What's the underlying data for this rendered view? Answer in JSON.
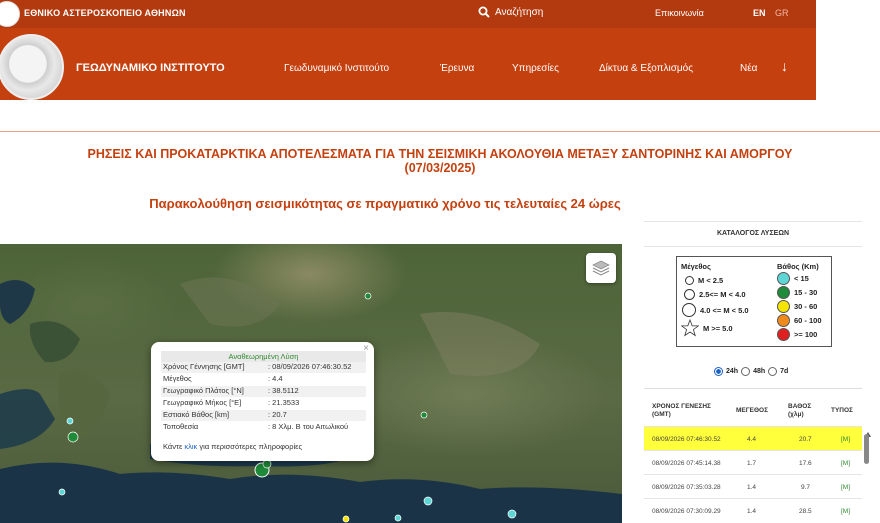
{
  "topbar": {
    "org_name": "ΕΘΝΙΚΟ ΑΣΤΕΡΟΣΚΟΠΕΙΟ ΑΘΗΝΩΝ",
    "search_label": "Αναζήτηση",
    "contact": "Επικοινωνία",
    "lang_en": "EN",
    "lang_gr": "GR"
  },
  "navbar": {
    "institute": "ΓΕΩΔΥΝΑΜΙΚΟ ΙΝΣΤΙΤΟΥΤΟ",
    "items": [
      "Γεωδυναμικό Ινστιτούτο",
      "Έρευνα",
      "Υπηρεσίες",
      "Δίκτυα & Εξοπλισμός",
      "Νέα"
    ],
    "arrow": "↓"
  },
  "headline": {
    "line1": "ΡΗΣΕΙΣ ΚΑΙ ΠΡΟΚΑΤΑΡΚΤΙΚΑ ΑΠΟΤΕΛΕΣΜΑΤΑ ΓΙΑ ΤΗΝ ΣΕΙΣΜΙΚΗ ΑΚΟΛΟΥΘΙΑ ΜΕΤΑΞΥ ΣΑΝΤΟΡΙΝΗΣ ΚΑΙ ΑΜΟΡΓΟΥ",
    "line2": "(07/03/2025)"
  },
  "subheadline": "Παρακολούθηση σεισμικότητας σε πραγματικό χρόνο τις τελευταίες 24 ώρες",
  "popup": {
    "title": "Αναθεωρημένη Λύση",
    "close": "×",
    "rows": [
      {
        "k": "Χρόνος Γέννησης [GMT]",
        "v": ": 08/09/2026 07:46:30.52"
      },
      {
        "k": "Μέγεθος",
        "v": ": 4.4"
      },
      {
        "k": "Γεωγραφικό Πλάτος [°N]",
        "v": ": 38.5112"
      },
      {
        "k": "Γεωγραφικό Μήκος [°E]",
        "v": ": 21.3533"
      },
      {
        "k": "Εστιακό Βάθος [km]",
        "v": ": 20.7"
      },
      {
        "k": "Τοποθεσία",
        "v": ": 8 Χλμ. Β του Αιτωλικού"
      }
    ],
    "more_pre": "Κάντε ",
    "more_link": "κλικ",
    "more_post": " για περισσότερες πληροφορίες"
  },
  "sidebar": {
    "catalog_title": "ΚΑΤΑΛΟΓΟΣ ΛΥΣΕΩΝ",
    "legend": {
      "mag_header": "Μέγεθος",
      "depth_header": "Βάθος (Km)",
      "mag_items": [
        "M < 2.5",
        "2.5<= M < 4.0",
        "4.0 <= M < 5.0",
        "M >= 5.0"
      ],
      "depth_items": [
        {
          "label": "< 15",
          "color": "#5fd6d6"
        },
        {
          "label": "15 - 30",
          "color": "#1f8a3a"
        },
        {
          "label": "30 - 60",
          "color": "#f5e400"
        },
        {
          "label": "60 - 100",
          "color": "#f08a1c"
        },
        {
          "label": ">= 100",
          "color": "#e02020"
        }
      ]
    },
    "range": {
      "opt1": "24h",
      "opt2": "48h",
      "opt3": "7d",
      "selected": "24h"
    },
    "table": {
      "headers": {
        "time": "ΧΡΟΝΟΣ ΓΕΝΕΣΗΣ (GMT)",
        "mag": "ΜΕΓΕΘΟΣ",
        "depth": "ΒΑΘΟΣ (χλμ)",
        "type": "ΤΥΠΟΣ"
      },
      "rows": [
        {
          "time": "08/09/2026 07:46:30.52",
          "mag": "4.4",
          "depth": "20.7",
          "type": "[M]"
        },
        {
          "time": "08/09/2026 07:45:14.38",
          "mag": "1.7",
          "depth": "17.6",
          "type": "[M]"
        },
        {
          "time": "08/09/2026 07:35:03.28",
          "mag": "1.4",
          "depth": "9.7",
          "type": "[M]"
        },
        {
          "time": "08/09/2026 07:30:09.29",
          "mag": "1.4",
          "depth": "28.5",
          "type": "[M]"
        }
      ]
    }
  },
  "colors": {
    "brand_dark": "#b33a0e",
    "brand": "#c5400f",
    "highlight": "#ffff3b"
  }
}
